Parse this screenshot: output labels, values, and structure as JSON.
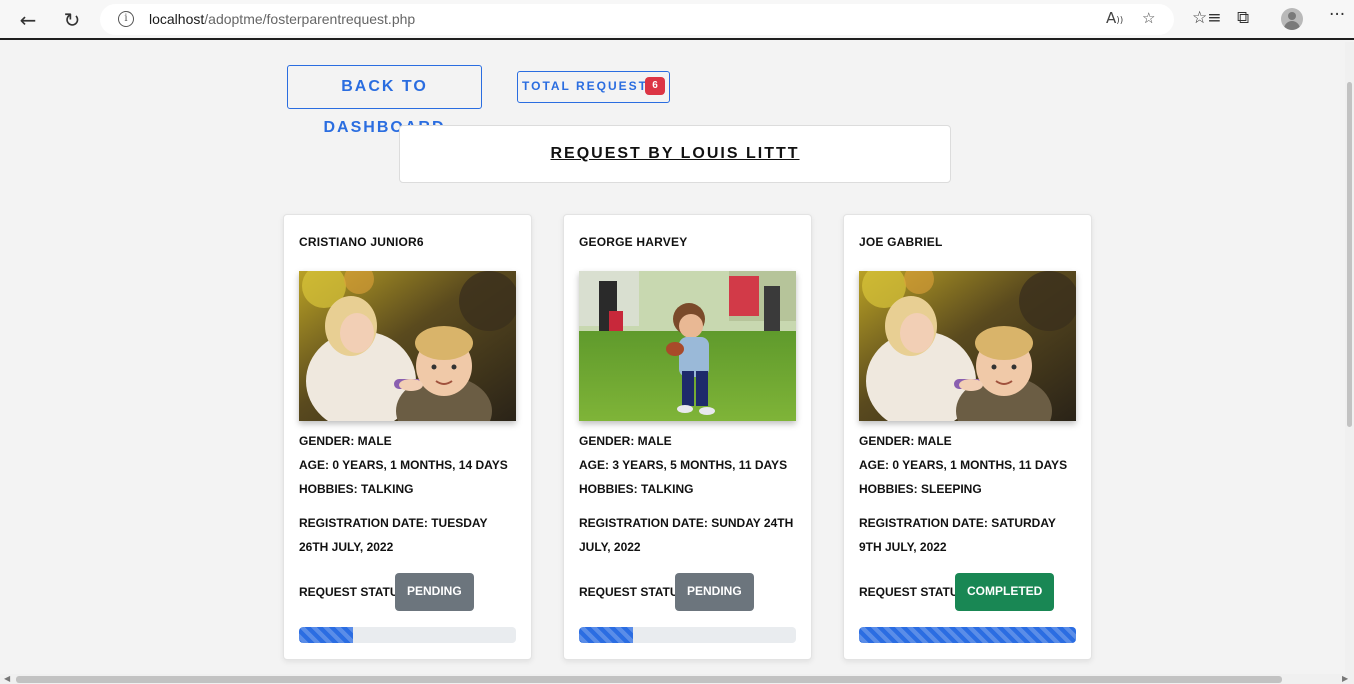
{
  "browser": {
    "url_host": "localhost",
    "url_path": "/adoptme/fosterparentrequest.php"
  },
  "page": {
    "back_button": "Back to Dashboard",
    "total_requests_label": "Total Requests",
    "total_requests_count": "6",
    "header_title": "Request by Louis Littt"
  },
  "cards": [
    {
      "name": "Cristiano Junior6",
      "photo": "two-children-autumn-photo",
      "gender": "Gender: Male",
      "age": "Age: 0 Years, 1 Months, 14 Days",
      "hobbies": "Hobbies: Talking",
      "registration": "Registration Date: Tuesday 26th July, 2022",
      "status_label": "Request Status:",
      "status": "Pending",
      "status_color": "#6c757d",
      "progress_percent": 25
    },
    {
      "name": "George Harvey",
      "photo": "child-with-football-photo",
      "gender": "Gender: Male",
      "age": "Age: 3 Years, 5 Months, 11 Days",
      "hobbies": "Hobbies: Talking",
      "registration": "Registration Date: Sunday 24th July, 2022",
      "status_label": "Request Status:",
      "status": "Pending",
      "status_color": "#6c757d",
      "progress_percent": 25
    },
    {
      "name": "Joe Gabriel",
      "photo": "two-children-autumn-photo",
      "gender": "Gender: Male",
      "age": "Age: 0 Years, 1 Months, 11 Days",
      "hobbies": "Hobbies: Sleeping",
      "registration": "Registration Date: Saturday 9th July, 2022",
      "status_label": "Request Status:",
      "status": "Completed",
      "status_color": "#198754",
      "progress_percent": 100
    }
  ],
  "colors": {
    "accent": "#2a6de0",
    "badge_red": "#dc3545",
    "progress": "#2b6de2"
  }
}
